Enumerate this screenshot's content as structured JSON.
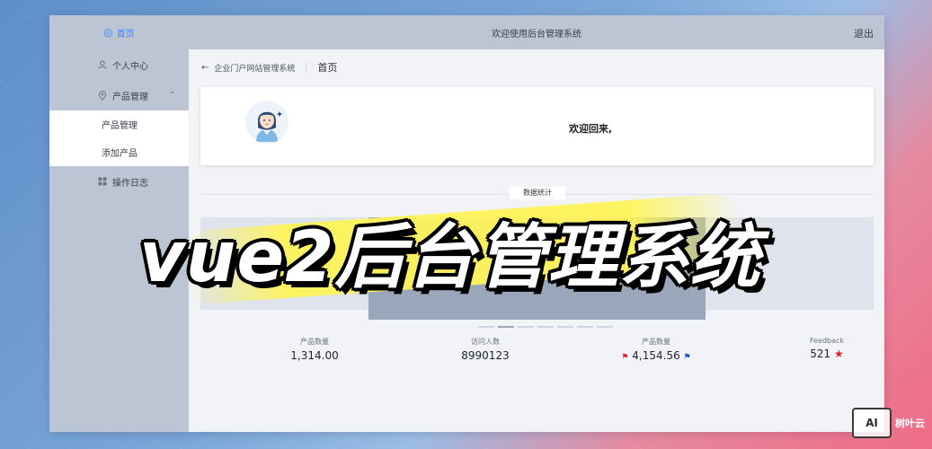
{
  "sidebar": {
    "home_label": "首页",
    "items": [
      {
        "label": "个人中心",
        "icon": "user-icon"
      },
      {
        "label": "产品管理",
        "icon": "location-pin-icon",
        "expanded": true
      }
    ],
    "submenu": [
      {
        "label": "产品管理"
      },
      {
        "label": "添加产品"
      }
    ],
    "log_item": {
      "label": "操作日志",
      "icon": "grid-icon"
    }
  },
  "topbar": {
    "title": "欢迎使用后台管理系统",
    "logout": "退出"
  },
  "breadcrumb": {
    "site": "企业门户网站管理系统",
    "current": "首页"
  },
  "welcome": {
    "text": "欢迎回来,"
  },
  "section": {
    "label": "数据统计"
  },
  "stats": [
    {
      "label": "产品数量",
      "value": "1,314.00"
    },
    {
      "label": "访问人数",
      "value": "8990123"
    },
    {
      "label": "产品数量",
      "value": "4,154.56"
    },
    {
      "label": "Feedback",
      "value": "521"
    }
  ],
  "overlay": {
    "title": "vue2后台管理系统"
  },
  "watermark": {
    "logo": "AI",
    "text": "树叶云"
  },
  "colors": {
    "accent": "#3b82f6",
    "sidebar_bg": "#bcc5d3",
    "highlight": "#fff45a",
    "star": "#e11d2e"
  }
}
